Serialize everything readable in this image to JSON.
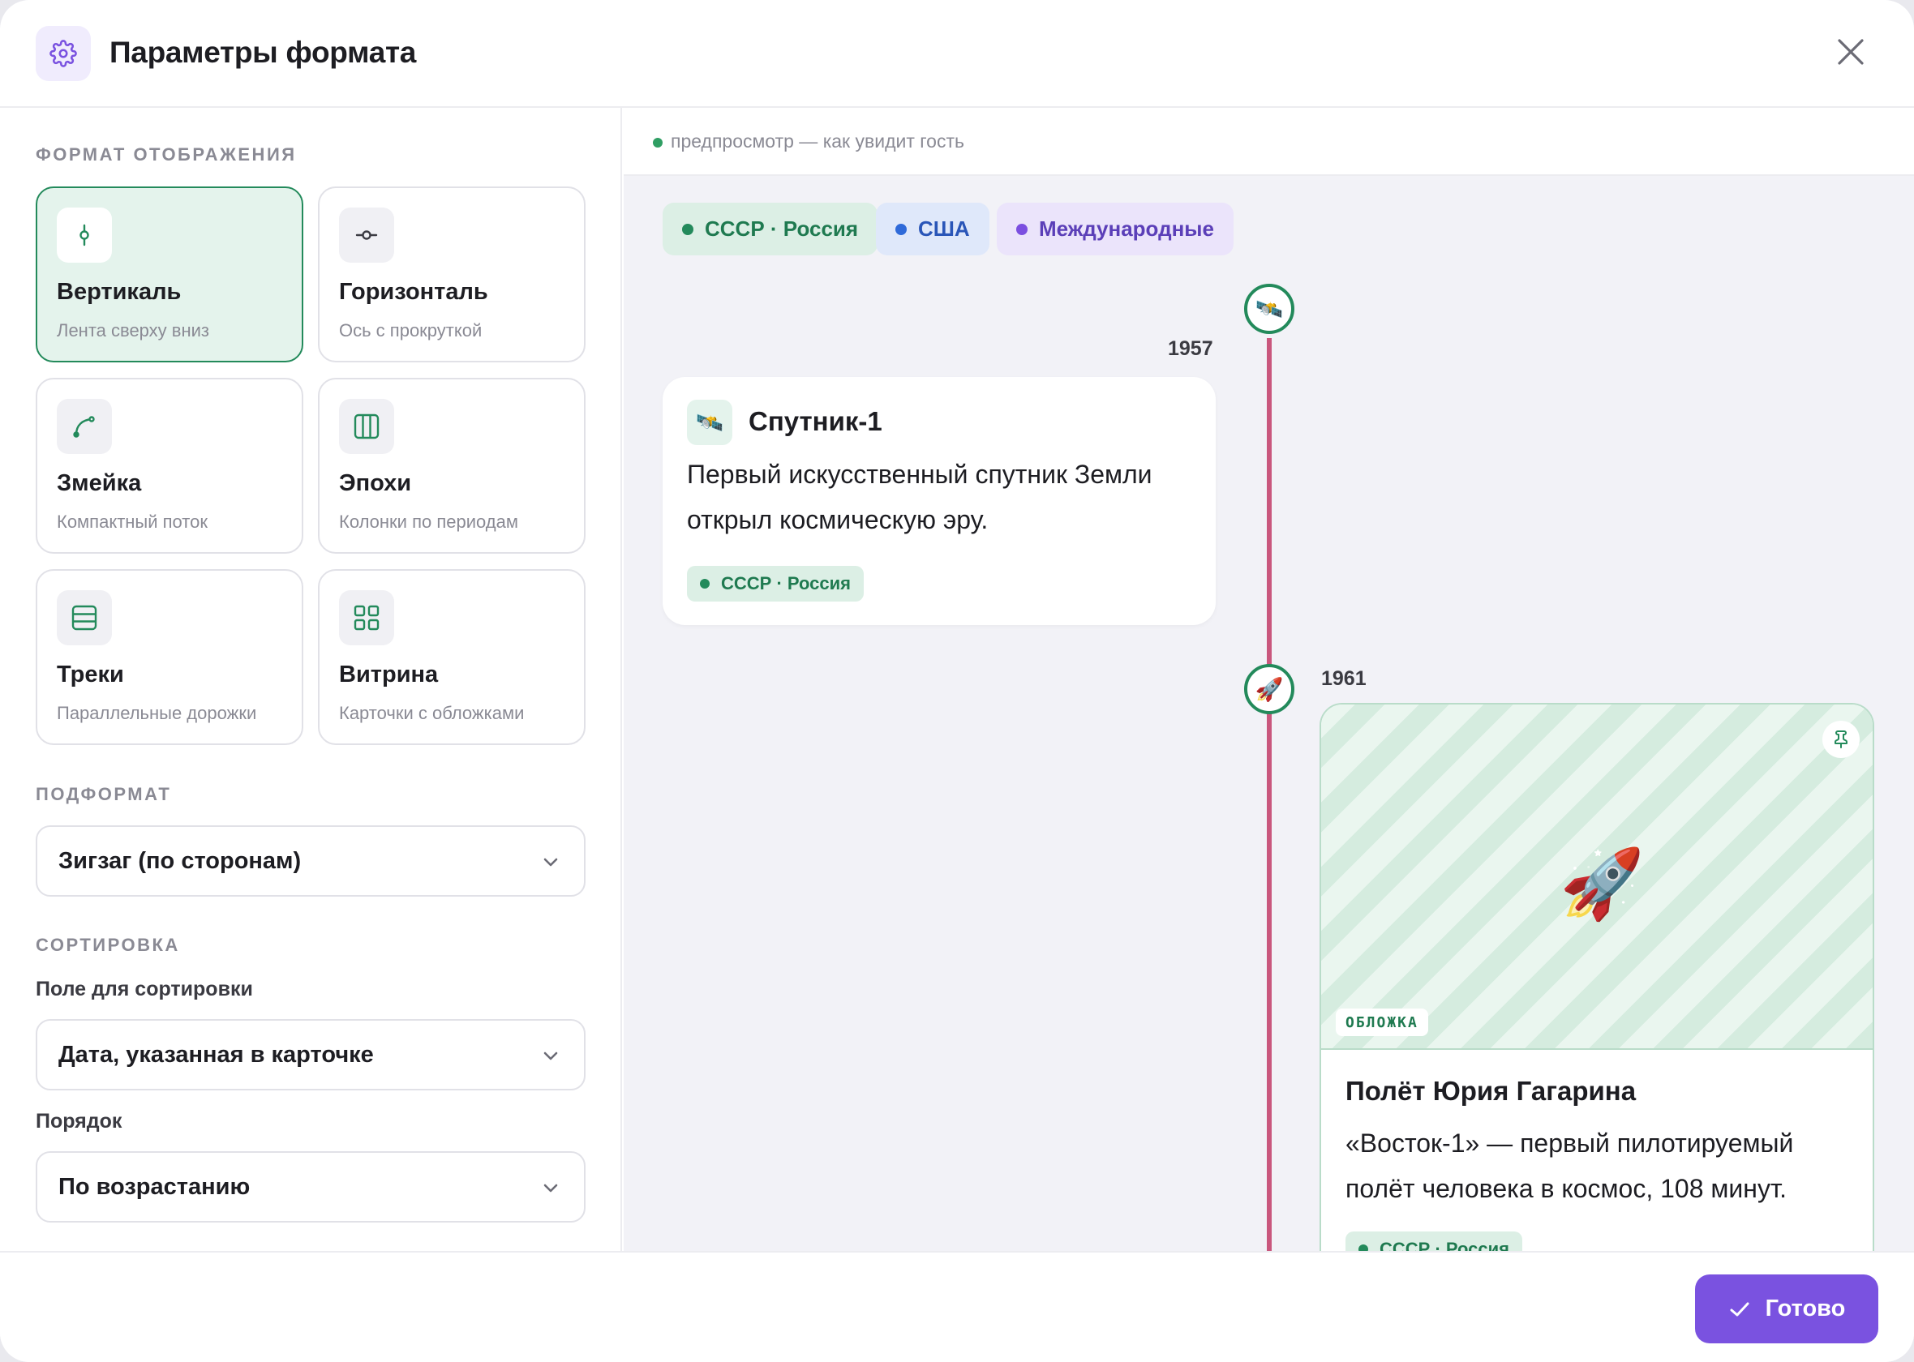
{
  "header": {
    "title": "Параметры формата",
    "icon": "gear-icon"
  },
  "sidebar": {
    "format_label": "ФОРМАТ ОТОБРАЖЕНИЯ",
    "formats": [
      {
        "title": "Вертикаль",
        "subtitle": "Лента сверху вниз",
        "icon": "vertical-axis-icon",
        "selected": true
      },
      {
        "title": "Горизонталь",
        "subtitle": "Ось с прокруткой",
        "icon": "horizontal-axis-icon",
        "selected": false
      },
      {
        "title": "Змейка",
        "subtitle": "Компактный поток",
        "icon": "curve-icon",
        "selected": false
      },
      {
        "title": "Эпохи",
        "subtitle": "Колонки по периодам",
        "icon": "columns-icon",
        "selected": false
      },
      {
        "title": "Треки",
        "subtitle": "Параллельные дорожки",
        "icon": "rows-icon",
        "selected": false
      },
      {
        "title": "Витрина",
        "subtitle": "Карточки с обложками",
        "icon": "grid-icon",
        "selected": false
      }
    ],
    "subformat_label": "ПОДФОРМАТ",
    "subformat_value": "Зигзаг (по сторонам)",
    "sort_label": "СОРТИРОВКА",
    "sort_field_label": "Поле для сортировки",
    "sort_field_value": "Дата, указанная в карточке",
    "order_label": "Порядок",
    "order_value": "По возрастанию"
  },
  "preview": {
    "label": "предпросмотр — как увидит гость",
    "chips": [
      "СССР · Россия",
      "США",
      "Международные"
    ],
    "events": [
      {
        "year": "1957",
        "emoji": "🛰️",
        "title": "Спутник-1",
        "text_line1": "Первый искусственный спутник Земли",
        "text_line2": "открыл космическую эру.",
        "tag": "СССР · Россия"
      },
      {
        "year": "1961",
        "emoji": "🚀",
        "cover_badge": "ОБЛОЖКА",
        "title": "Полёт Юрия Гагарина",
        "text_line1": "«Восток-1» — первый пилотируемый",
        "text_line2": "полёт человека в космос, 108 минут.",
        "tag": "СССР · Россия"
      }
    ]
  },
  "footer": {
    "done_label": "Готово"
  },
  "colors": {
    "accent": "#7a52e0",
    "green": "#238a5b",
    "axis": "#c9577d",
    "blue": "#2f6ad9",
    "purple": "#7b4fe0"
  }
}
